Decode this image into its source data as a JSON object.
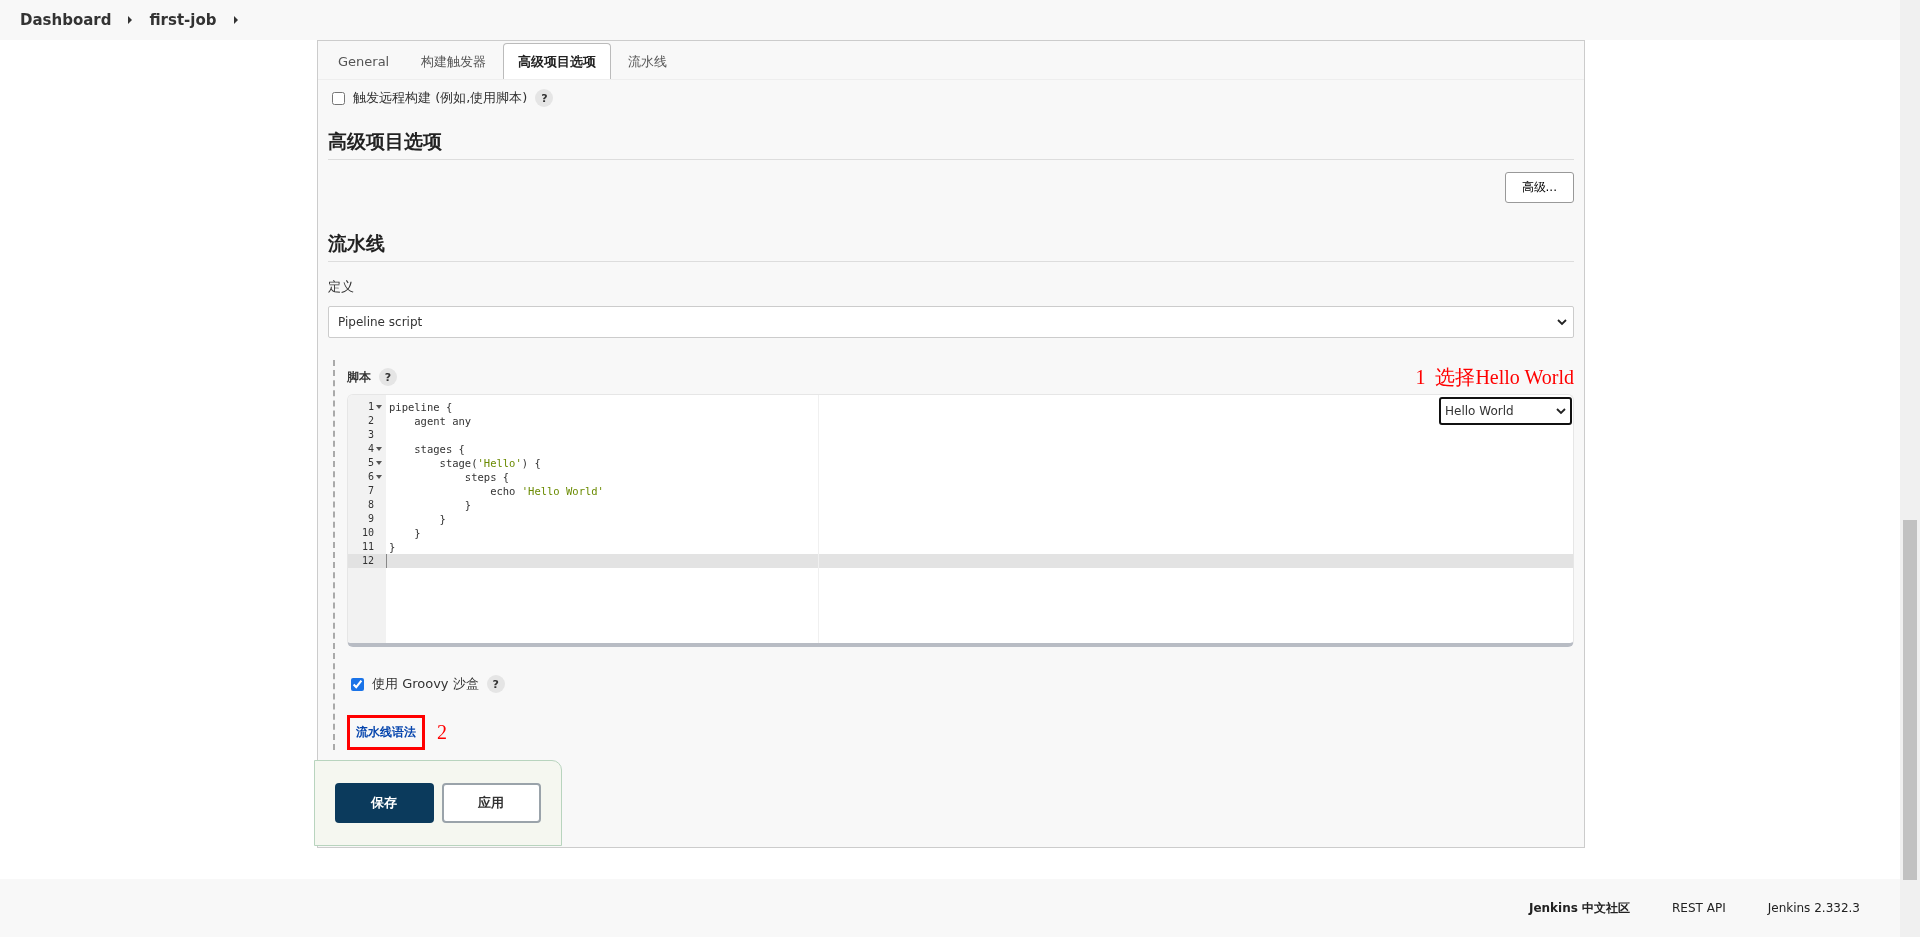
{
  "breadcrumbs": [
    {
      "label": "Dashboard"
    },
    {
      "label": "first-job"
    }
  ],
  "tabs": [
    {
      "label": "General",
      "selected": false
    },
    {
      "label": "构建触发器",
      "selected": false
    },
    {
      "label": "高级项目选项",
      "selected": true
    },
    {
      "label": "流水线",
      "selected": false
    }
  ],
  "trigger_option": {
    "label": "触发远程构建 (例如,使用脚本)",
    "checked": false,
    "help": "?"
  },
  "advanced_section": {
    "title": "高级项目选项",
    "button": "高级..."
  },
  "pipeline_section": {
    "title": "流水线",
    "definition_label": "定义",
    "definition_value": "Pipeline script",
    "script_label": "脚本",
    "script_help": "?",
    "annotation_1": "1  选择Hello World",
    "sample_select": "Hello World",
    "code_lines": [
      {
        "number": "1",
        "fold": true,
        "active": false,
        "tokens": [
          {
            "kind": "plain",
            "text": "pipeline {"
          }
        ]
      },
      {
        "number": "2",
        "fold": false,
        "active": false,
        "tokens": [
          {
            "kind": "plain",
            "text": "    agent any"
          }
        ]
      },
      {
        "number": "3",
        "fold": false,
        "active": false
      },
      {
        "number": "4",
        "fold": true,
        "active": false,
        "tokens": [
          {
            "kind": "plain",
            "text": "    stages {"
          }
        ]
      },
      {
        "number": "5",
        "fold": true,
        "active": false,
        "tokens": [
          {
            "kind": "plain",
            "text": "        stage("
          },
          {
            "kind": "string",
            "text": "'Hello'"
          },
          {
            "kind": "plain",
            "text": ") {"
          }
        ]
      },
      {
        "number": "6",
        "fold": true,
        "active": false,
        "tokens": [
          {
            "kind": "plain",
            "text": "            steps {"
          }
        ]
      },
      {
        "number": "7",
        "fold": false,
        "active": false,
        "tokens": [
          {
            "kind": "plain",
            "text": "                echo "
          },
          {
            "kind": "string",
            "text": "'Hello World'"
          }
        ]
      },
      {
        "number": "8",
        "fold": false,
        "active": false,
        "tokens": [
          {
            "kind": "plain",
            "text": "            }"
          }
        ]
      },
      {
        "number": "9",
        "fold": false,
        "active": false,
        "tokens": [
          {
            "kind": "plain",
            "text": "        }"
          }
        ]
      },
      {
        "number": "10",
        "fold": false,
        "active": false,
        "tokens": [
          {
            "kind": "plain",
            "text": "    }"
          }
        ]
      },
      {
        "number": "11",
        "fold": false,
        "active": false,
        "tokens": [
          {
            "kind": "plain",
            "text": "}"
          }
        ]
      },
      {
        "number": "12",
        "fold": false,
        "active": true
      }
    ],
    "sandbox": {
      "label": "使用 Groovy 沙盒",
      "checked": true,
      "help": "?"
    },
    "syntax_link": "流水线语法",
    "annotation_2": "2"
  },
  "buttons": [
    {
      "label": "保存",
      "kind": "primary"
    },
    {
      "label": "应用",
      "kind": "secondary"
    }
  ],
  "footer": [
    {
      "label": "Jenkins 中文社区"
    },
    {
      "label": "REST API"
    },
    {
      "label": "Jenkins 2.332.3"
    }
  ]
}
